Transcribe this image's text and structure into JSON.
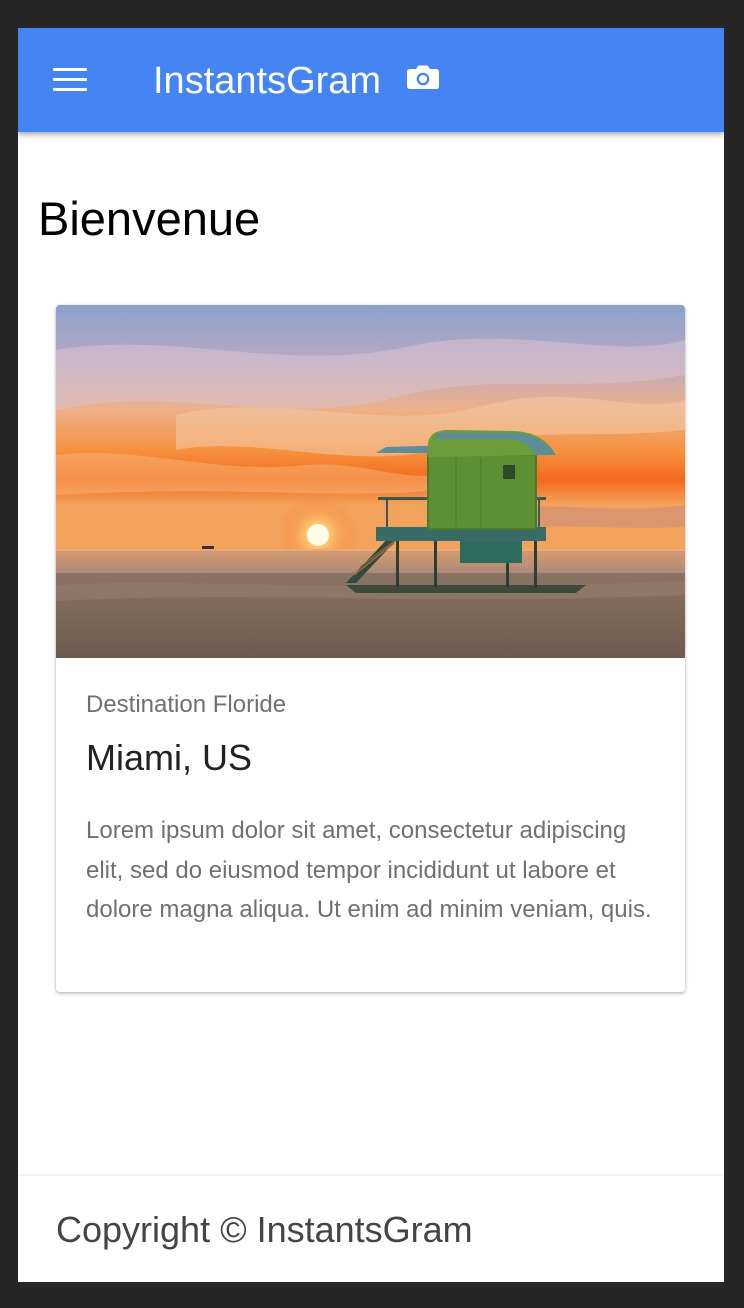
{
  "app_bar": {
    "title": "InstantsGram",
    "menu_icon": "hamburger-menu-icon",
    "title_icon": "camera-icon",
    "background_color": "#4485f3"
  },
  "page": {
    "title": "Bienvenue"
  },
  "card": {
    "image": "beach-lifeguard-tower-sunset-photo",
    "subtitle": "Destination Floride",
    "title": "Miami, US",
    "text": "Lorem ipsum dolor sit amet, consectetur adipiscing elit, sed do eiusmod tempor incididunt ut labore et dolore magna aliqua. Ut enim ad minim veniam, quis."
  },
  "footer": {
    "text": "Copyright © InstantsGram"
  }
}
